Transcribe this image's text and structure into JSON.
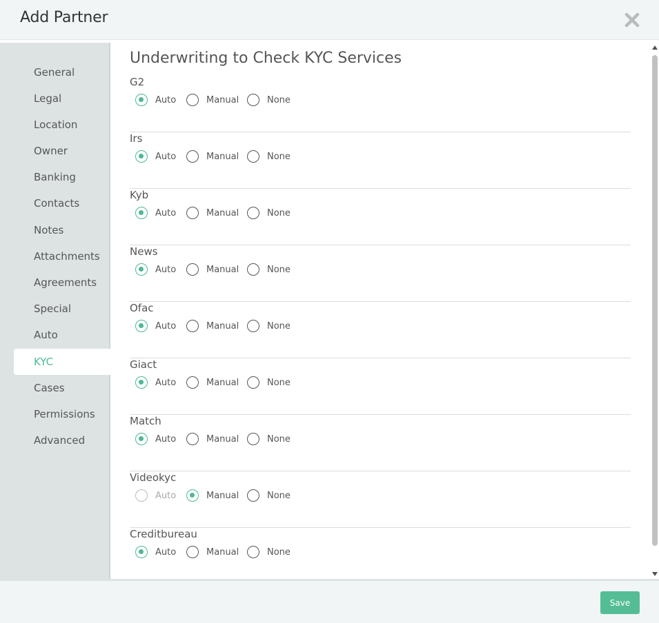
{
  "modal": {
    "title": "Add Partner",
    "close_icon": "close-icon"
  },
  "sidebar": {
    "items": [
      {
        "label": "General"
      },
      {
        "label": "Legal"
      },
      {
        "label": "Location"
      },
      {
        "label": "Owner"
      },
      {
        "label": "Banking"
      },
      {
        "label": "Contacts"
      },
      {
        "label": "Notes"
      },
      {
        "label": "Attachments"
      },
      {
        "label": "Agreements"
      },
      {
        "label": "Special"
      },
      {
        "label": "Auto"
      },
      {
        "label": "KYC"
      },
      {
        "label": "Cases"
      },
      {
        "label": "Permissions"
      },
      {
        "label": "Advanced"
      }
    ],
    "active": "KYC"
  },
  "main": {
    "title": "Underwriting to Check KYC Services",
    "options": [
      "Auto",
      "Manual",
      "None"
    ],
    "services": [
      {
        "name": "G2",
        "selected": "Auto",
        "auto_disabled": false
      },
      {
        "name": "Irs",
        "selected": "Auto",
        "auto_disabled": false
      },
      {
        "name": "Kyb",
        "selected": "Auto",
        "auto_disabled": false
      },
      {
        "name": "News",
        "selected": "Auto",
        "auto_disabled": false
      },
      {
        "name": "Ofac",
        "selected": "Auto",
        "auto_disabled": false
      },
      {
        "name": "Giact",
        "selected": "Auto",
        "auto_disabled": false
      },
      {
        "name": "Match",
        "selected": "Auto",
        "auto_disabled": false
      },
      {
        "name": "Videokyc",
        "selected": "Manual",
        "auto_disabled": true
      },
      {
        "name": "Creditbureau",
        "selected": "Auto",
        "auto_disabled": false
      }
    ]
  },
  "footer": {
    "save_label": "Save"
  },
  "colors": {
    "accent": "#4db894",
    "save_button": "#55bd95",
    "sidebar_bg": "#dde3e3",
    "header_bg": "#f1f5f5"
  }
}
